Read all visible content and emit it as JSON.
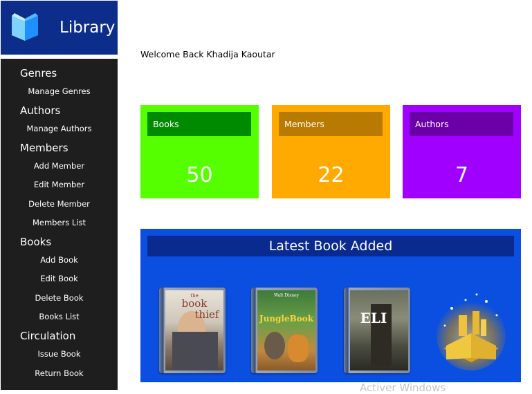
{
  "app": {
    "title": "Library"
  },
  "welcome": "Welcome Back Khadija Kaoutar",
  "sidebar": {
    "sections": [
      {
        "title": "Genres",
        "items": [
          "Manage Genres"
        ]
      },
      {
        "title": "Authors",
        "items": [
          "Manage Authors"
        ]
      },
      {
        "title": "Members",
        "items": [
          "Add Member",
          "Edit Member",
          "Delete Member",
          "Members List"
        ]
      },
      {
        "title": "Books",
        "items": [
          "Add Book",
          "Edit Book",
          "Delete Book",
          "Books List"
        ]
      },
      {
        "title": "Circulation",
        "items": [
          "Issue Book",
          "Return Book"
        ]
      }
    ]
  },
  "stats": {
    "books": {
      "label": "Books",
      "value": "50",
      "color": "#55ff00",
      "label_bg": "#008a00"
    },
    "members": {
      "label": "Members",
      "value": "22",
      "color": "#ffaa00",
      "label_bg": "#b87a00"
    },
    "authors": {
      "label": "Authors",
      "value": "7",
      "color": "#a000ff",
      "label_bg": "#6b00a8"
    }
  },
  "latest": {
    "title": "Latest Book Added",
    "books": [
      {
        "cover_text": [
          "the",
          "book",
          "thief"
        ]
      },
      {
        "cover_text": [
          "Walt Disney",
          "JungleBook"
        ]
      },
      {
        "cover_text": [
          "ELI"
        ]
      },
      {
        "cover_text": []
      }
    ]
  },
  "watermark": "Activer Windows",
  "colors": {
    "sidebar": "#1e1e1e",
    "logo_bg": "#0d2d8a",
    "latest_bg": "#0a4fe0",
    "latest_title_bg": "#0a2a90"
  }
}
